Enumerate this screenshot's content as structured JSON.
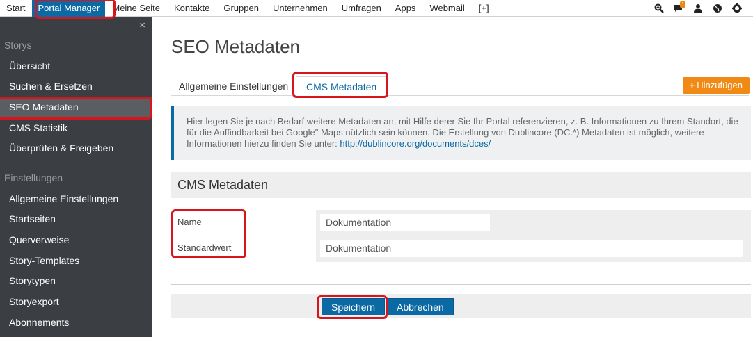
{
  "topnav": {
    "items": [
      "Start",
      "Portal Manager",
      "Meine Seite",
      "Kontakte",
      "Gruppen",
      "Unternehmen",
      "Umfragen",
      "Apps",
      "Webmail",
      "[+]"
    ],
    "active": "Portal Manager",
    "notification_count": "1",
    "icons": [
      "search-icon",
      "chat-icon",
      "user-icon",
      "globe-icon",
      "settings-icon"
    ]
  },
  "sidebar": {
    "close_glyph": "×",
    "section1": "Storys",
    "items1": [
      "Übersicht",
      "Suchen & Ersetzen",
      "SEO Metadaten",
      "CMS Statistik",
      "Überprüfen & Freigeben"
    ],
    "section2": "Einstellungen",
    "items2": [
      "Allgemeine Einstellungen",
      "Startseiten",
      "Querverweise",
      "Story-Templates",
      "Storytypen",
      "Storyexport",
      "Abonnements"
    ],
    "active": "SEO Metadaten"
  },
  "main": {
    "title": "SEO Metadaten",
    "tabs": [
      "Allgemeine Einstellungen",
      "CMS Metadaten"
    ],
    "active_tab": "CMS Metadaten",
    "add_button": "Hinzufügen",
    "info_text": "Hier legen Sie je nach Bedarf weitere Metadaten an, mit Hilfe derer Sie Ihr Portal referenzieren, z. B. Informationen zu Ihrem Standort, die für die Auffindbarkeit bei Google\" Maps nützlich sein können. Die Erstellung von Dublincore (DC.*) Metadaten ist möglich, weitere Informationen hierzu finden Sie unter: ",
    "info_link": "http://dublincore.org/documents/dces/",
    "section_title": "CMS Metadaten",
    "form": {
      "name_label": "Name",
      "name_value": "Dokumentation",
      "default_label": "Standardwert",
      "default_value": "Dokumentation"
    },
    "save_button": "Speichern",
    "cancel_button": "Abbrechen"
  },
  "colors": {
    "accent": "#0b6aa3",
    "sidebar_bg": "#3b3f44",
    "add_button": "#f08a14",
    "highlight": "#d8141c"
  }
}
